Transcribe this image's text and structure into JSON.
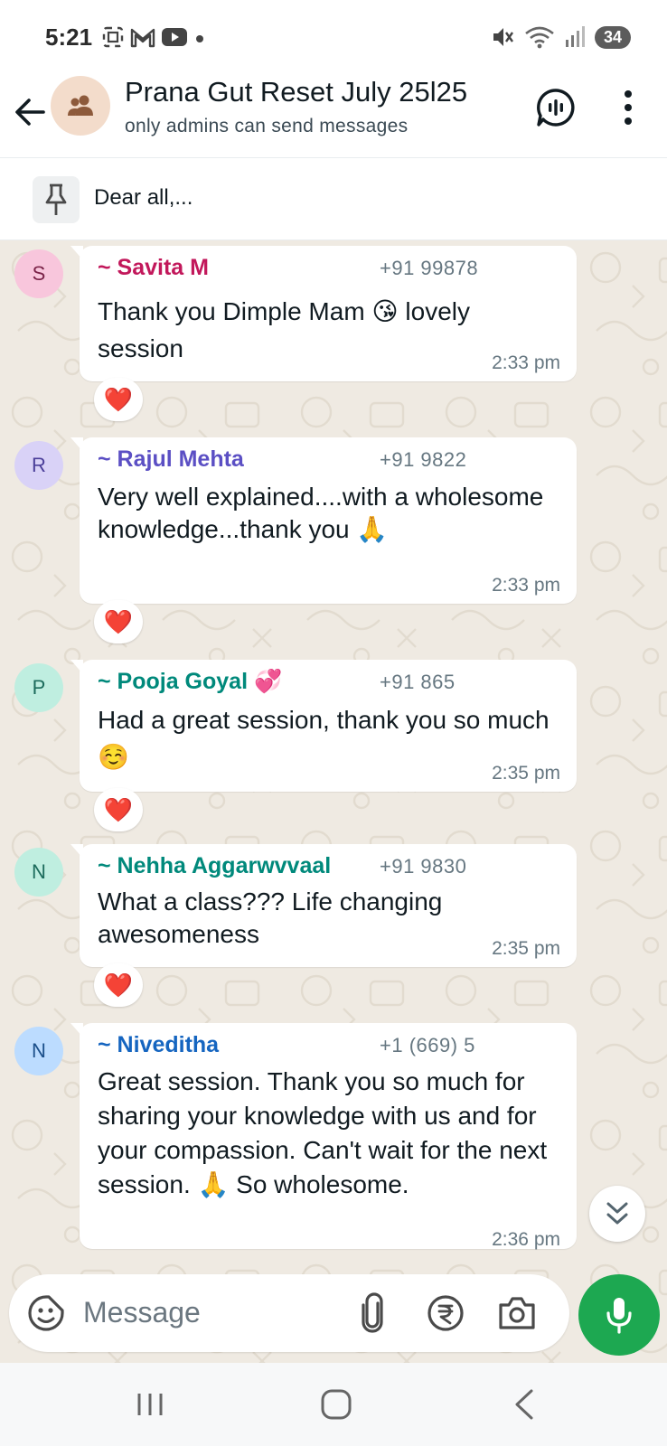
{
  "status_bar": {
    "time": "5:21",
    "battery": "34",
    "left_icons": [
      "screenshot-icon",
      "gmail-icon",
      "youtube-icon",
      "dot-icon"
    ],
    "right_icons": [
      "mute-icon",
      "wifi-icon",
      "signal-icon"
    ]
  },
  "header": {
    "title": "Prana Gut Reset July 25l25",
    "subtitle": "only admins can send messages"
  },
  "pinned": {
    "text": "Dear all,..."
  },
  "messages": [
    {
      "initial": "S",
      "sender": "~ Savita M",
      "phone": "+91 99878",
      "text": "Thank you Dimple Mam 😘 lovely session",
      "time": "2:33 pm",
      "reaction": "❤️",
      "sender_color": "#c2185b",
      "avatar_bg": "#f8c6dc",
      "avatar_fg": "#7a2348"
    },
    {
      "initial": "R",
      "sender": "~ Rajul Mehta",
      "phone": "+91 9822",
      "text": "Very well explained....with a wholesome knowledge...thank you 🙏",
      "time": "2:33 pm",
      "reaction": "❤️",
      "sender_color": "#5b4fc4",
      "avatar_bg": "#d9d2f7",
      "avatar_fg": "#4b3f9a"
    },
    {
      "initial": "P",
      "sender": "~ Pooja Goyal 💞",
      "phone": "+91 865",
      "text": "Had a great session, thank you so much ☺️",
      "time": "2:35 pm",
      "reaction": "❤️",
      "sender_color": "#00897b",
      "avatar_bg": "#bfeee0",
      "avatar_fg": "#1c6b5c"
    },
    {
      "initial": "N",
      "sender": "~ Nehha Aggarwvvaal",
      "phone": "+91 9830",
      "text": "What a class??? Life changing awesomeness",
      "time": "2:35 pm",
      "reaction": "❤️",
      "sender_color": "#00897b",
      "avatar_bg": "#bfeee0",
      "avatar_fg": "#1c6b5c"
    },
    {
      "initial": "N",
      "sender": "~ Niveditha",
      "phone": "+1 (669) 5",
      "text": "Great session. Thank you so much for sharing your knowledge with us and for your compassion.  Can't wait for the next session.  🙏 So wholesome.",
      "time": "2:36 pm",
      "reaction": "",
      "sender_color": "#1565c0",
      "avatar_bg": "#bcdcff",
      "avatar_fg": "#1b4f8a"
    }
  ],
  "composer": {
    "placeholder": "Message"
  },
  "colors": {
    "accent_green": "#1da851",
    "chat_bg": "#efeae2"
  }
}
